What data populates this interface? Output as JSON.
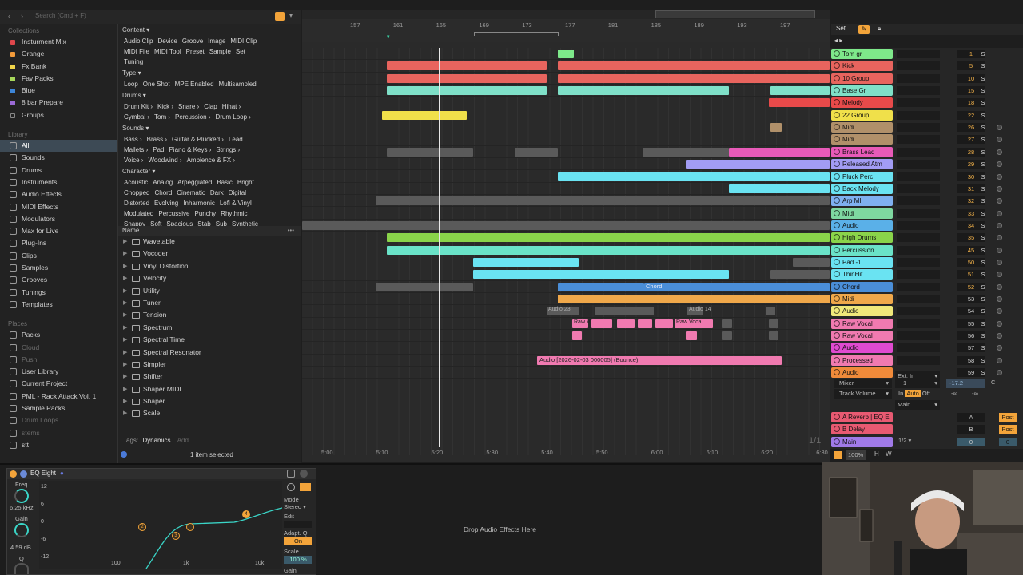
{
  "browser_top": {
    "search_placeholder": "Search (Cmd + F)"
  },
  "sidebar": {
    "collections_header": "Collections",
    "collections": [
      {
        "label": "Insturment Mix",
        "color": "#e0474c"
      },
      {
        "label": "Orange",
        "color": "#f39b3a"
      },
      {
        "label": "Fx Bank",
        "color": "#f0d44a"
      },
      {
        "label": "Fav Packs",
        "color": "#a6d75a"
      },
      {
        "label": "Blue",
        "color": "#3d86d8"
      },
      {
        "label": "8 bar Prepare",
        "color": "#9b6ad6"
      },
      {
        "label": "Groups",
        "color": ""
      }
    ],
    "library_header": "Library",
    "library": [
      "All",
      "Sounds",
      "Drums",
      "Instruments",
      "Audio Effects",
      "MIDI Effects",
      "Modulators",
      "Max for Live",
      "Plug-Ins",
      "Clips",
      "Samples",
      "Grooves",
      "Tunings",
      "Templates"
    ],
    "places_header": "Places",
    "places": [
      {
        "label": "Packs",
        "dim": false
      },
      {
        "label": "Cloud",
        "dim": true
      },
      {
        "label": "Push",
        "dim": true
      },
      {
        "label": "User Library",
        "dim": false
      },
      {
        "label": "Current Project",
        "dim": false
      },
      {
        "label": "PML - Rack Attack Vol. 1",
        "dim": false
      },
      {
        "label": "Sample Packs",
        "dim": false
      },
      {
        "label": "Drum Loops",
        "dim": true
      },
      {
        "label": "stems",
        "dim": true
      },
      {
        "label": "stt",
        "dim": false
      }
    ]
  },
  "filters": {
    "content_label": "Content ▾",
    "content_row1": [
      "Audio Clip",
      "Device",
      "Groove",
      "Image",
      "MIDI Clip"
    ],
    "content_row2": [
      "MIDI File",
      "MIDI Tool",
      "Preset",
      "Sample",
      "Set"
    ],
    "content_row3": [
      "Tuning"
    ],
    "type_label": "Type ▾",
    "type_row": [
      "Loop",
      "One Shot",
      "MPE Enabled",
      "Multisampled"
    ],
    "drums_label": "Drums ▾",
    "drums_row1": [
      "Drum Kit ›",
      "Kick ›",
      "Snare ›",
      "Clap",
      "Hihat ›"
    ],
    "drums_row2": [
      "Cymbal ›",
      "Tom ›",
      "Percussion ›",
      "Drum Loop ›"
    ],
    "sounds_label": "Sounds ▾",
    "sounds_row1": [
      "Bass ›",
      "Brass ›",
      "Guitar & Plucked ›",
      "Lead"
    ],
    "sounds_row2": [
      "Mallets ›",
      "Pad",
      "Piano & Keys ›",
      "Strings ›"
    ],
    "sounds_row3": [
      "Voice ›",
      "Woodwind ›",
      "Ambience & FX ›"
    ],
    "character_label": "Character ▾",
    "char_row1": [
      "Acoustic",
      "Analog",
      "Arpeggiated",
      "Basic",
      "Bright"
    ],
    "char_row2": [
      "Chopped",
      "Chord",
      "Cinematic",
      "Dark",
      "Digital"
    ],
    "char_row3": [
      "Distorted",
      "Evolving",
      "Inharmonic",
      "Lofi & Vinyl"
    ],
    "char_row4": [
      "Modulated",
      "Percussive",
      "Punchy",
      "Rhythmic"
    ],
    "char_row5": [
      "Snappy",
      "Soft",
      "Spacious",
      "Stab",
      "Sub",
      "Synthetic"
    ]
  },
  "list": {
    "name_header": "Name",
    "items": [
      "Wavetable",
      "Vocoder",
      "Vinyl Distortion",
      "Velocity",
      "Utility",
      "Tuner",
      "Tension",
      "Spectrum",
      "Spectral Time",
      "Spectral Resonator",
      "Simpler",
      "Shifter",
      "Shaper MIDI",
      "Shaper",
      "Scale"
    ],
    "tags_label": "Tags:",
    "tags_value": "Dynamics",
    "tags_add": "Add...",
    "status": "1 item selected"
  },
  "ruler": {
    "bars": [
      "157",
      "161",
      "165",
      "169",
      "173",
      "177",
      "181",
      "185",
      "189",
      "193",
      "197"
    ],
    "times": [
      "5:00",
      "5:10",
      "5:20",
      "5:30",
      "5:40",
      "5:50",
      "6:00",
      "6:10",
      "6:20",
      "6:30"
    ],
    "set_label": "Set",
    "fraction": "1/1"
  },
  "tracks": [
    {
      "name": "Tom gr",
      "color": "#7ee88a",
      "num": "1",
      "solo": "S"
    },
    {
      "name": "Kick",
      "color": "#e8645e",
      "num": "5",
      "solo": "S"
    },
    {
      "name": "10 Group",
      "color": "#e8645e",
      "num": "10",
      "solo": "S"
    },
    {
      "name": "Base Gr",
      "color": "#7fe0c8",
      "num": "15",
      "solo": "S"
    },
    {
      "name": "Melody",
      "color": "#e84a4a",
      "num": "18",
      "solo": "S"
    },
    {
      "name": "22 Group",
      "color": "#f0e04a",
      "num": "22",
      "solo": "S"
    },
    {
      "name": "Midi",
      "color": "#b0906a",
      "num": "26",
      "solo": "S"
    },
    {
      "name": "Midi",
      "color": "#b0906a",
      "num": "27",
      "solo": "S"
    },
    {
      "name": "Brass Lead",
      "color": "#e85ab8",
      "num": "28",
      "solo": "S"
    },
    {
      "name": "Released Atm",
      "color": "#a29cf4",
      "num": "29",
      "solo": "S"
    },
    {
      "name": "Pluck Perc",
      "color": "#6ae3f2",
      "num": "30",
      "solo": "S"
    },
    {
      "name": "Back Melody",
      "color": "#6ae3f2",
      "num": "31",
      "solo": "S"
    },
    {
      "name": "Arp MI",
      "color": "#7fb0f0",
      "num": "32",
      "solo": "S"
    },
    {
      "name": "Midi",
      "color": "#7ed8a0",
      "num": "33",
      "solo": "S"
    },
    {
      "name": "Audio",
      "color": "#5ab0e8",
      "num": "34",
      "solo": "S"
    },
    {
      "name": "High Drums",
      "color": "#8ad44a",
      "num": "35",
      "solo": "S"
    },
    {
      "name": "Percussion",
      "color": "#6ae3c8",
      "num": "45",
      "solo": "S"
    },
    {
      "name": "Pad -1",
      "color": "#6ae3f2",
      "num": "50",
      "solo": "S"
    },
    {
      "name": "ThinHit",
      "color": "#6ae3f2",
      "num": "51",
      "solo": "S"
    },
    {
      "name": "Chord",
      "color": "#4a8ed8",
      "num": "52",
      "solo": "S"
    },
    {
      "name": "Midi",
      "color": "#f0a84a",
      "num": "53",
      "solo": "S"
    },
    {
      "name": "Audio",
      "color": "#f0e87a",
      "num": "54",
      "solo": "S"
    },
    {
      "name": "Raw Vocal",
      "color": "#f07ab0",
      "num": "55",
      "solo": "S"
    },
    {
      "name": "Raw Vocal",
      "color": "#f07ab0",
      "num": "56",
      "solo": "S"
    },
    {
      "name": "Audio",
      "color": "#e04ad0",
      "num": "57",
      "solo": "S"
    },
    {
      "name": "Processed",
      "color": "#f07ab0",
      "num": "58",
      "solo": "S"
    },
    {
      "name": "Audio",
      "color": "#f08a3a",
      "num": "59",
      "solo": "S"
    }
  ],
  "io": {
    "ext_in": "Ext. In",
    "mixer": "Mixer",
    "one": "1",
    "track_volume": "Track Volume",
    "in": "In",
    "auto": "Auto",
    "off": "Off",
    "main": "Main",
    "vol": "-17.2",
    "pan": "C",
    "inf1": "-∞",
    "inf2": "-∞"
  },
  "returns": [
    {
      "name": "A Reverb | EQ E",
      "letter": "A",
      "post": "Post",
      "color": "#e85a72"
    },
    {
      "name": "B Delay",
      "letter": "B",
      "post": "Post",
      "color": "#e85a72"
    },
    {
      "name": "Main",
      "letter": "0",
      "post": "0",
      "color": "#a07ae8"
    }
  ],
  "main_extra": {
    "half": "1/2"
  },
  "transport": {
    "zoom": "100%",
    "h": "H",
    "w": "W"
  },
  "clips": {
    "chord": "Chord",
    "bounce": "Audio [2026-02-03 000005] (Bounce)",
    "audio23": "Audio 23",
    "audio14": "Audio 14",
    "rawvoca": "Raw Voca",
    "rawv": "Raw V"
  },
  "eq": {
    "title": "EQ Eight",
    "freq_label": "Freq",
    "freq_value": "6.25 kHz",
    "gain_label": "Gain",
    "gain_value": "4.59 dB",
    "q_label": "Q",
    "db_ticks": [
      "12",
      "6",
      "0",
      "-6",
      "-12"
    ],
    "hz_ticks": [
      "100",
      "1k",
      "10k"
    ],
    "mode_label": "Mode",
    "mode_value": "Stereo ▾",
    "edit_label": "Edit",
    "adapt_label": "Adapt. Q",
    "adapt_value": "On",
    "scale_label": "Scale",
    "scale_value": "100 %",
    "gain2_label": "Gain",
    "bands": [
      "2",
      "3",
      "4"
    ]
  },
  "drop_text": "Drop Audio Effects Here"
}
